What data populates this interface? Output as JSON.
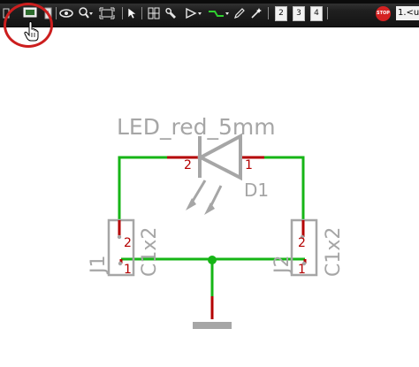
{
  "toolbar": {
    "page_buttons": [
      "2",
      "3",
      "4"
    ],
    "stop_label": "STOP",
    "command_field_value": "1.<un"
  },
  "schematic": {
    "led_value": "LED_red_5mm",
    "led_name": "D1",
    "led_pin_anode": "2",
    "led_pin_cathode": "1",
    "j1_name": "J1",
    "j1_value": "C1x2",
    "j1_pin_top": "2",
    "j1_pin_bottom": "1",
    "j2_name": "J2",
    "j2_value": "C1x2",
    "j2_pin_top": "2",
    "j2_pin_bottom": "1"
  },
  "colors": {
    "wire": "#16b516",
    "pin": "#b40000",
    "symbol": "#a6a6a6",
    "highlight": "#cc1e1e"
  }
}
